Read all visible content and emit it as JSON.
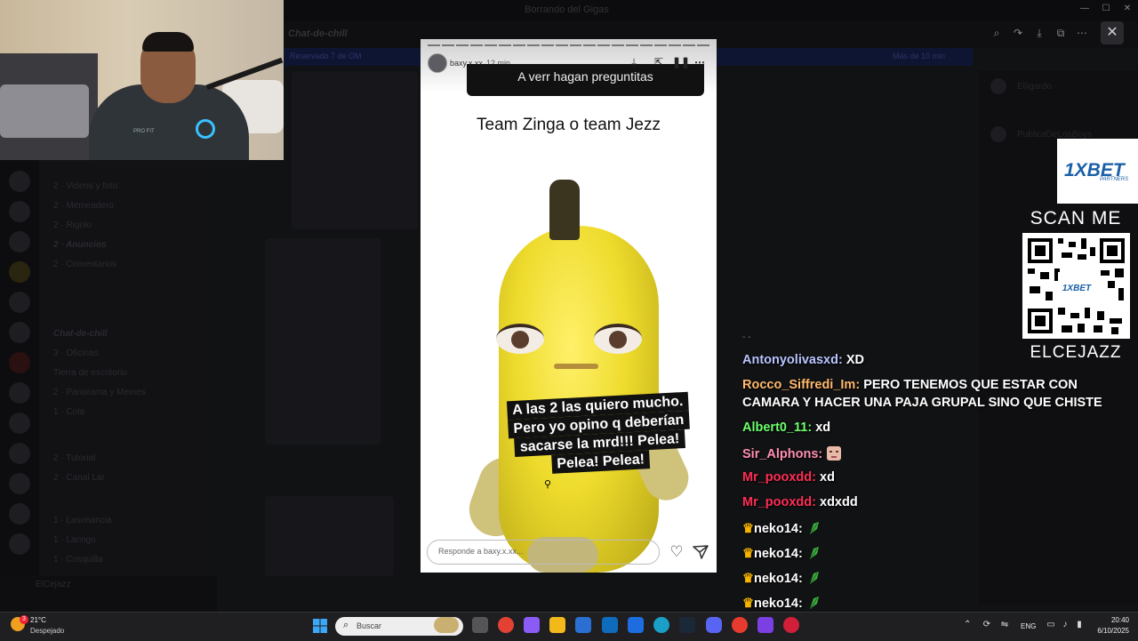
{
  "background_app": {
    "window_title": "Borrando del Gigas",
    "channel_title": "Chat-de-chill",
    "notice": "Reservado 7 de OM",
    "notice_right": "Más de 10 min",
    "channels": [
      "2 · Videos y foto",
      "2 · Memeadero",
      "2 · Rigolo",
      "2 · Anuncios",
      "2 · Comentarios",
      "Chat-de-chill",
      "3 · Oficinas",
      "Tierra de escritorio",
      "2 · Panorama y Memes",
      "1 · Cola",
      "2 · Tutorial",
      "2 · Canal Lar",
      "1 · Lasonancia",
      "1 · Laringo",
      "1 · Cosquilla"
    ],
    "members": [
      "Elligardo",
      "PublicaDeLosBoys"
    ],
    "username": "ElCejazz"
  },
  "webcam": {
    "shirt_logo": "PRO FIT"
  },
  "story": {
    "username": "baxy.x.xx",
    "time": "12 min",
    "question": "A verr hagan preguntitas",
    "team_text": "Team Zinga o team Jezz",
    "caption_lines": [
      "A las 2 las quiero mucho.",
      "Pero yo opino q deberían",
      "sacarse la mrd!!! Pelea!",
      "Pelea! Pelea!"
    ],
    "reply_placeholder": "Responde a baxy.x.xx...",
    "icons": {
      "download": "download-icon",
      "pause": "pause-icon",
      "more": "more-icon",
      "heart": "heart-icon",
      "send": "send-icon"
    }
  },
  "overlay_toolbar": {
    "icons": [
      "zoom-icon",
      "rotate-icon",
      "download-icon",
      "open-external-icon",
      "more-icon"
    ],
    "close": "✕"
  },
  "sponsor": {
    "logo": "1XBET",
    "logo_sub": "PARTNERS",
    "scan_text": "SCAN ME",
    "qr_label": "ELCEJAZZ",
    "qr_center": "1XBET"
  },
  "chat": {
    "messages": [
      {
        "user": "Antonyolivasxd:",
        "text": "XD",
        "color": "#b8c4ff"
      },
      {
        "user": "Rocco_Siffredi_Im:",
        "text": "PERO TENEMOS QUE ESTAR CON",
        "text2": "CAMARA Y HACER UNA PAJA GRUPAL SINO QUE CHISTE",
        "color": "#ffb86b"
      },
      {
        "user": "Albert0_11:",
        "text": "xd",
        "color": "#6dff6d"
      },
      {
        "user": "Sir_Alphons:",
        "text": "",
        "color": "#ff8fb1",
        "emote": "face-emote"
      },
      {
        "user": "Mr_pooxdd:",
        "text": "xd",
        "color": "#ff2d55"
      },
      {
        "user": "Mr_pooxdd:",
        "text": "xdxdd",
        "color": "#ff2d55"
      },
      {
        "user": "neko14:",
        "text": "",
        "color": "#ffffff",
        "emote": "leaf-emote",
        "badge": "crown"
      },
      {
        "user": "neko14:",
        "text": "",
        "color": "#ffffff",
        "emote": "leaf-emote",
        "badge": "crown"
      },
      {
        "user": "neko14:",
        "text": "",
        "color": "#ffffff",
        "emote": "leaf-emote",
        "badge": "crown"
      },
      {
        "user": "neko14:",
        "text": "",
        "color": "#ffffff",
        "emote": "leaf-emote",
        "badge": "crown"
      },
      {
        "user": "neko14:",
        "text": "",
        "color": "#ffffff",
        "emote": "leaf-emote",
        "badge": "crown"
      }
    ]
  },
  "taskbar": {
    "weather_badge": "3",
    "temperature": "21°C",
    "weather": "Despejado",
    "search_placeholder": "Buscar",
    "language": "ENG",
    "time": "20:40",
    "date": "6/10/2025"
  }
}
